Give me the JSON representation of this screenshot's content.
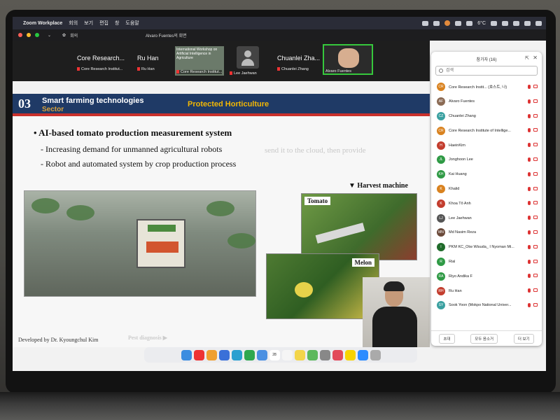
{
  "menubar": {
    "app_name": "Zoom Workplace",
    "menus": [
      "회의",
      "보기",
      "편집",
      "창",
      "도움말"
    ],
    "temperature": "6°C",
    "status_icons": [
      "cloud-icon",
      "people-icon",
      "mic-orange-icon",
      "cc-icon",
      "dropbox-icon",
      "weather-icon",
      "bluetooth-icon",
      "wifi-icon",
      "search-icon",
      "control-center-icon",
      "siri-icon"
    ]
  },
  "zoombar": {
    "left_label": "회의",
    "window_title": "Alvaro Fuentes의 회면"
  },
  "gallery": {
    "tiles": [
      {
        "big": "Core Research...",
        "small": "Core Research Institut..."
      },
      {
        "big": "Ru Han",
        "small": "Ru Han"
      },
      {
        "workshop_text": "International Workshop on Artificial Intelligence in Agriculture",
        "small": "Core Research Institut..."
      },
      {
        "small": "Lee Jaehwan"
      },
      {
        "big": "Chuanlei Zha...",
        "small": "Chuanlei Zhang"
      },
      {
        "small": "Alvaro Fuentes"
      }
    ]
  },
  "slide": {
    "number": "03",
    "section": "Smart farming technologies",
    "sector": "Sector",
    "tag": "Protected Horticulture",
    "bullet_title": "AI-based tomato production measurement system",
    "sub_items": [
      "- Increasing demand for unmanned agricultural robots",
      "- Robot and automated system by crop production process"
    ],
    "ghost_text": "send it to the cloud, then provide",
    "harvest_label": "▼ Harvest machine",
    "tomato_label": "Tomato",
    "melon_label": "Melon",
    "developer": "Developed by Dr. Kyoungchul Kim",
    "pest": "Pest diagnosis ▶"
  },
  "panel": {
    "title": "참가자 (16)",
    "search_placeholder": "검색",
    "participants": [
      {
        "initials": "CR",
        "name": "Core Research Instit... (호스트, 나)",
        "color": "#d9821f"
      },
      {
        "initials": "AF",
        "name": "Alvaro Fuentes",
        "color": "#8b6b55"
      },
      {
        "initials": "CZ",
        "name": "Chuanlei Zhang",
        "color": "#3aa0a0"
      },
      {
        "initials": "CR",
        "name": "Core Research Institute of Intellige...",
        "color": "#d9821f"
      },
      {
        "initials": "H",
        "name": "HaeinKim",
        "color": "#c33d2e"
      },
      {
        "initials": "JL",
        "name": "Jonghoon Lee",
        "color": "#2f9a45"
      },
      {
        "initials": "KH",
        "name": "Kai Huang",
        "color": "#2f9a45"
      },
      {
        "initials": "K",
        "name": "Khalid",
        "color": "#d9821f"
      },
      {
        "initials": "K",
        "name": "Khoa Tô Anh",
        "color": "#c33d2e"
      },
      {
        "initials": "LJ",
        "name": "Lee Jaehwan",
        "color": "#555555"
      },
      {
        "initials": "MN",
        "name": "Md Nasim Reza",
        "color": "#6b4a3a"
      },
      {
        "initials": "I",
        "name": "PKM KC_Otw Wisuda_ I Nyoman Mi...",
        "color": "#1f6b2a"
      },
      {
        "initials": "R",
        "name": "Rial",
        "color": "#2f9a45"
      },
      {
        "initials": "RA",
        "name": "Riyo Andika F",
        "color": "#2f9a45"
      },
      {
        "initials": "RH",
        "name": "Ru Han",
        "color": "#c33d2e"
      },
      {
        "initials": "SY",
        "name": "Sook Yoon (Mokpo National Univer...",
        "color": "#3aa0a0"
      }
    ],
    "footer": [
      "초대",
      "모두 음소거",
      "더 보기"
    ]
  },
  "dock": {
    "date_day": "28",
    "icons": [
      "finder-icon",
      "youtube-icon",
      "photos-icon",
      "send-icon",
      "edge-icon",
      "chrome-icon",
      "mail-icon",
      "calendar-icon",
      "reminders-icon",
      "notes-icon",
      "maps-icon",
      "settings-icon",
      "music-icon",
      "kakao-icon",
      "zoom-icon",
      "trash-icon"
    ]
  }
}
